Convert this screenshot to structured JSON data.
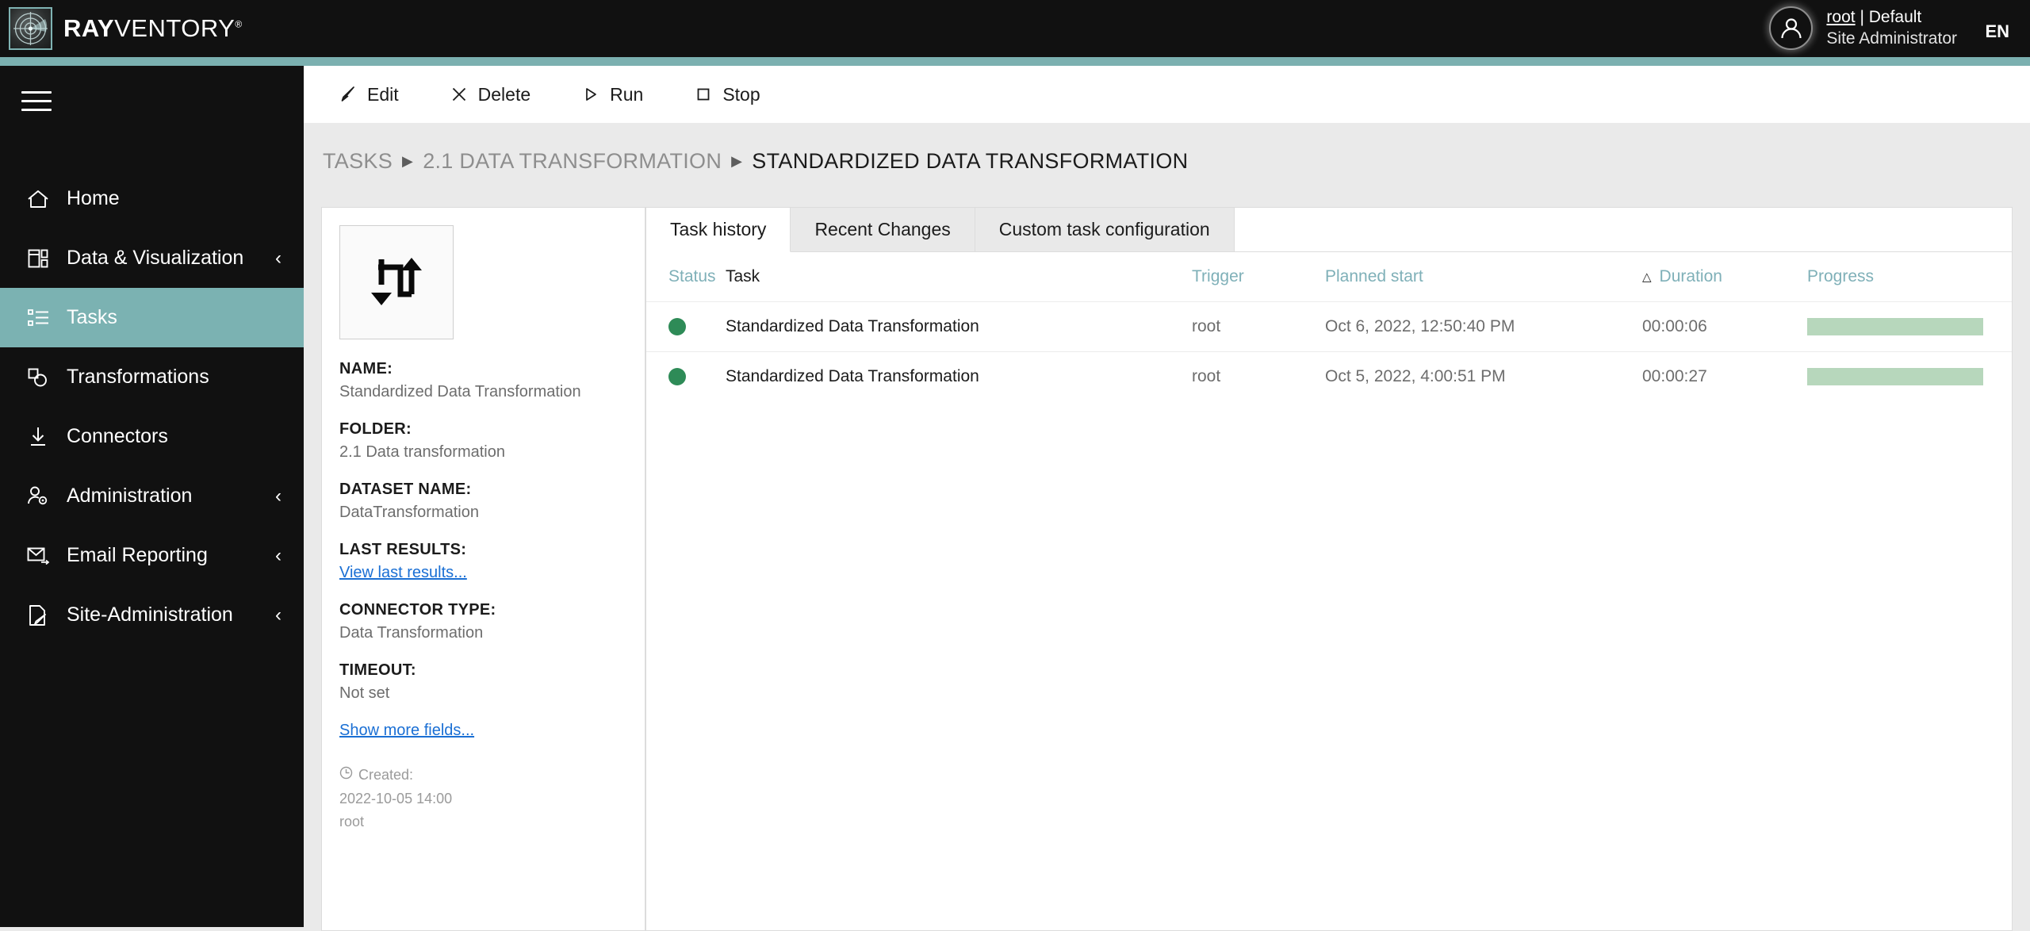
{
  "brand": {
    "name_bold": "RAY",
    "name_light": "VENTORY",
    "trademark": "®",
    "logo_icon": "radar-icon",
    "accent_color": "#7bb0b0",
    "header_bg": "#111111"
  },
  "header": {
    "avatar_icon": "user-avatar-icon",
    "user_line1_link": "root",
    "user_line1_rest": " | Default",
    "user_line2": "Site Administrator",
    "language": "EN"
  },
  "sidebar": {
    "menu_icon": "hamburger-icon",
    "active_color": "#7bb2b2",
    "items": [
      {
        "label": "Home",
        "icon": "home-icon",
        "expandable": false,
        "active": false
      },
      {
        "label": "Data & Visualization",
        "icon": "dashboard-icon",
        "expandable": true,
        "active": false
      },
      {
        "label": "Tasks",
        "icon": "task-list-icon",
        "expandable": false,
        "active": true
      },
      {
        "label": "Transformations",
        "icon": "transformations-icon",
        "expandable": false,
        "active": false
      },
      {
        "label": "Connectors",
        "icon": "download-arrow-icon",
        "expandable": false,
        "active": false
      },
      {
        "label": "Administration",
        "icon": "user-gear-icon",
        "expandable": true,
        "active": false
      },
      {
        "label": "Email Reporting",
        "icon": "envelope-arrow-icon",
        "expandable": true,
        "active": false
      },
      {
        "label": "Site-Administration",
        "icon": "document-pen-icon",
        "expandable": true,
        "active": false
      }
    ],
    "chevron_icon": "chevron-left-icon"
  },
  "toolbar": {
    "buttons": [
      {
        "label": "Edit",
        "icon": "pencil-icon"
      },
      {
        "label": "Delete",
        "icon": "close-x-icon"
      },
      {
        "label": "Run",
        "icon": "play-triangle-icon"
      },
      {
        "label": "Stop",
        "icon": "stop-square-icon"
      }
    ]
  },
  "breadcrumb": {
    "separator_icon": "caret-right-icon",
    "items": [
      {
        "label": "TASKS",
        "current": false
      },
      {
        "label": "2.1 DATA TRANSFORMATION",
        "current": false
      },
      {
        "label": "STANDARDIZED DATA TRANSFORMATION",
        "current": true
      }
    ]
  },
  "detail": {
    "thumbnail_icon": "data-transformation-arrows-icon",
    "fields": [
      {
        "label": "NAME:",
        "value": "Standardized Data Transformation"
      },
      {
        "label": "FOLDER:",
        "value": "2.1 Data transformation"
      },
      {
        "label": "DATASET NAME:",
        "value": "DataTransformation"
      }
    ],
    "last_results_label": "LAST RESULTS:",
    "last_results_link": "View last results...",
    "connector_type_label": "CONNECTOR TYPE:",
    "connector_type_value": "Data Transformation",
    "timeout_label": "TIMEOUT:",
    "timeout_value": "Not set",
    "show_more_link": "Show more fields...",
    "created": {
      "icon": "clock-icon",
      "label": "Created:",
      "timestamp": "2022-10-05 14:00",
      "user": "root"
    }
  },
  "tabs": [
    {
      "label": "Task history",
      "active": true
    },
    {
      "label": "Recent Changes",
      "active": false
    },
    {
      "label": "Custom task configuration",
      "active": false
    }
  ],
  "table": {
    "columns": [
      {
        "key": "status",
        "label": "Status",
        "sorted": false
      },
      {
        "key": "task",
        "label": "Task",
        "sorted": false
      },
      {
        "key": "trigger",
        "label": "Trigger",
        "sorted": false
      },
      {
        "key": "planned_start",
        "label": "Planned start",
        "sorted": false
      },
      {
        "key": "duration",
        "label": "Duration",
        "sorted": true,
        "sort_icon": "sort-ascending-caret"
      },
      {
        "key": "progress",
        "label": "Progress",
        "sorted": false
      }
    ],
    "status_color": "#2e8b57",
    "progress_color": "#b7d7bc",
    "rows": [
      {
        "status": "success",
        "task": "Standardized Data Transformation",
        "trigger": "root",
        "planned_start": "Oct 6, 2022, 12:50:40 PM",
        "duration": "00:00:06",
        "progress_percent": 100
      },
      {
        "status": "success",
        "task": "Standardized Data Transformation",
        "trigger": "root",
        "planned_start": "Oct 5, 2022, 4:00:51 PM",
        "duration": "00:00:27",
        "progress_percent": 100
      }
    ]
  }
}
